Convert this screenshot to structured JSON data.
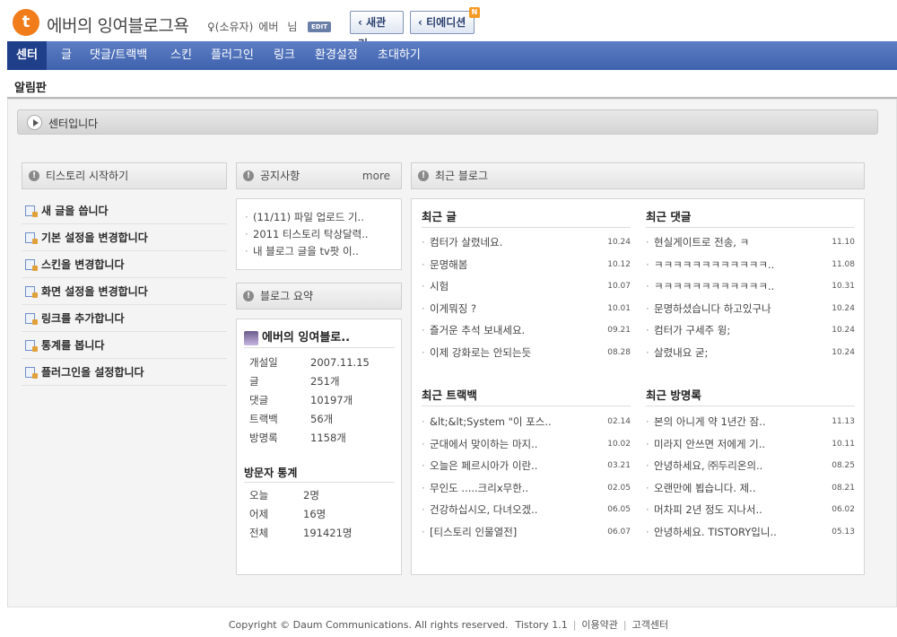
{
  "header": {
    "logo_glyph": "t",
    "blog_title": "에버의 잉여블로그욕",
    "owner_label": "♀(소유자)",
    "owner_name": "에버",
    "owner_suffix": "님",
    "edit_badge": "EDIT",
    "btn_new_manage": "‹ 새관리",
    "btn_tedition": "‹ 티에디션",
    "new_badge": "N"
  },
  "nav": {
    "items": [
      "센터",
      "글",
      "댓글/트랙백",
      "스킨",
      "플러그인",
      "링크",
      "환경설정",
      "초대하기"
    ],
    "active_index": 0
  },
  "sub_title": "알림판",
  "center_bar": {
    "label": "센터입니다"
  },
  "start_panel": {
    "title": "티스토리 시작하기",
    "items": [
      "새 글을 씁니다",
      "기본 설정을 변경합니다",
      "스킨을 변경합니다",
      "화면 설정을 변경합니다",
      "링크를 추가합니다",
      "통계를 봅니다",
      "플러그인을 설정합니다"
    ]
  },
  "notice_panel": {
    "title": "공지사항",
    "more": "more",
    "items": [
      "(11/11) 파일 업로드 기..",
      "2011 티스토리 탁상달력..",
      "내 블로그 글을 tv팟 이.."
    ]
  },
  "summary_panel": {
    "title": "블로그 요약",
    "blog_name": "에버의 잉여블로..",
    "stats": [
      {
        "label": "개설일",
        "value": "2007.11.15"
      },
      {
        "label": "글",
        "value": "251개"
      },
      {
        "label": "댓글",
        "value": "10197개"
      },
      {
        "label": "트랙백",
        "value": "56개"
      },
      {
        "label": "방명록",
        "value": "1158개"
      }
    ],
    "visit_title": "방문자 통계",
    "visits": [
      {
        "label": "오늘",
        "value": "2명"
      },
      {
        "label": "어제",
        "value": "16명"
      },
      {
        "label": "전체",
        "value": "191421명"
      }
    ]
  },
  "recent_panel": {
    "title": "최근 블로그",
    "posts": {
      "title": "최근 글",
      "items": [
        {
          "text": "컴터가 살렸네요.",
          "date": "10.24"
        },
        {
          "text": "문명해봄",
          "date": "10.12"
        },
        {
          "text": "시험",
          "date": "10.07"
        },
        {
          "text": "이게뭐징 ?",
          "date": "10.01"
        },
        {
          "text": "즐거운 추석 보내세요.",
          "date": "09.21"
        },
        {
          "text": "이제 강화로는 안되는듯",
          "date": "08.28"
        }
      ]
    },
    "comments": {
      "title": "최근 댓글",
      "items": [
        {
          "text": "현실게이트로 전송, ㅋ",
          "date": "11.10"
        },
        {
          "text": "ㅋㅋㅋㅋㅋㅋㅋㅋㅋㅋㅋㅋ..",
          "date": "11.08"
        },
        {
          "text": "ㅋㅋㅋㅋㅋㅋㅋㅋㅋㅋㅋㅋ..",
          "date": "10.31"
        },
        {
          "text": "문명하셨습니다 하고있구나",
          "date": "10.24"
        },
        {
          "text": "컴터가 구세주 윙;",
          "date": "10.24"
        },
        {
          "text": "살렸내요 굳;",
          "date": "10.24"
        }
      ]
    },
    "trackbacks": {
      "title": "최근 트랙백",
      "items": [
        {
          "text": "&lt;&lt;System \"이 포스..",
          "date": "02.14"
        },
        {
          "text": "군대에서 맞이하는 마지..",
          "date": "10.02"
        },
        {
          "text": "오늘은 페르시아가 이란..",
          "date": "03.21"
        },
        {
          "text": "무인도 .....크리x무한..",
          "date": "02.05"
        },
        {
          "text": "건강하십시오, 다녀오겠..",
          "date": "06.05"
        },
        {
          "text": "[티스토리 인물열전]",
          "date": "06.07"
        }
      ]
    },
    "guestbook": {
      "title": "최근 방명록",
      "items": [
        {
          "text": "본의 아니게 약 1년간 잠..",
          "date": "11.13"
        },
        {
          "text": "미라지 안쓰면 저에게 기..",
          "date": "10.11"
        },
        {
          "text": "안녕하세요, ㈜두리온의..",
          "date": "08.25"
        },
        {
          "text": "오랜만에 뵙습니다. 제..",
          "date": "08.21"
        },
        {
          "text": "머차피 2년 정도 지나서..",
          "date": "06.02"
        },
        {
          "text": "안녕하세요. TISTORY입니..",
          "date": "05.13"
        }
      ]
    }
  },
  "footer": {
    "copyright": "Copyright © Daum Communications. All rights reserved.",
    "version": "Tistory 1.1",
    "terms": "이용약관",
    "help": "고객센터",
    "sep": "|"
  }
}
